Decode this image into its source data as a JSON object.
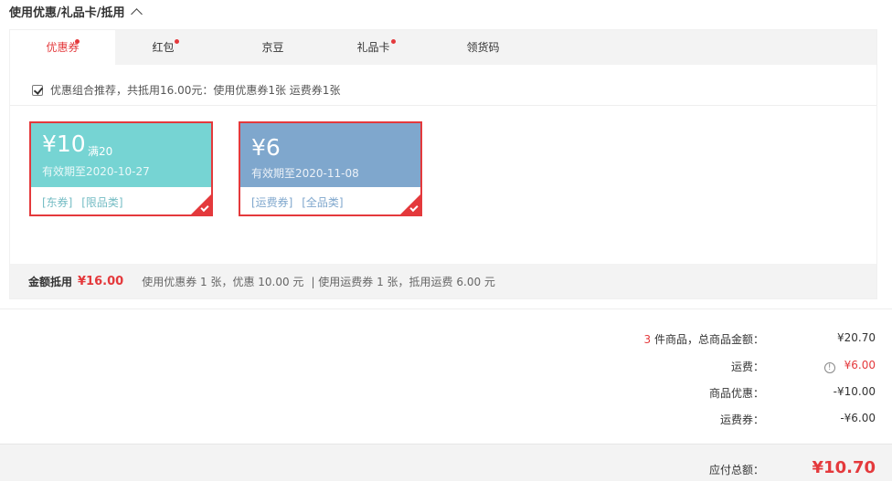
{
  "section": {
    "title": "使用优惠/礼品卡/抵用"
  },
  "tabs": [
    {
      "label": "优惠券",
      "dot": true
    },
    {
      "label": "红包",
      "dot": true
    },
    {
      "label": "京豆",
      "dot": false
    },
    {
      "label": "礼品卡",
      "dot": true
    },
    {
      "label": "领货码",
      "dot": false
    }
  ],
  "combo": {
    "text": "优惠组合推荐，共抵用16.00元：使用优惠券1张 运费券1张",
    "checked": true
  },
  "coupons": [
    {
      "amount": "¥10",
      "condition": "满20",
      "expiry": "有效期至2020-10-27",
      "tags": [
        "[东券]",
        "[限品类]"
      ],
      "color": "#76d4d3"
    },
    {
      "amount": "¥6",
      "condition": "",
      "expiry": "有效期至2020-11-08",
      "tags": [
        "[运费券]",
        "[全品类]"
      ],
      "color": "#7fa7cd"
    }
  ],
  "summary": {
    "label": "金额抵用",
    "value": "¥16.00",
    "detail1": "使用优惠券 1 张，优惠 10.00 元",
    "detail2": "| 使用运费券 1 张，抵用运费 6.00 元"
  },
  "totals": {
    "count": "3",
    "goods_label": " 件商品，总商品金额：",
    "goods_amount": "¥20.70",
    "freight_label": "运费：",
    "freight_amount": "¥6.00",
    "discount_label": "商品优惠：",
    "discount_amount": "-¥10.00",
    "freight_coupon_label": "运费券：",
    "freight_coupon_amount": "-¥6.00"
  },
  "payable": {
    "label": "应付总额：",
    "amount": "¥10.70"
  },
  "colors": {
    "accent": "#e4393c"
  }
}
